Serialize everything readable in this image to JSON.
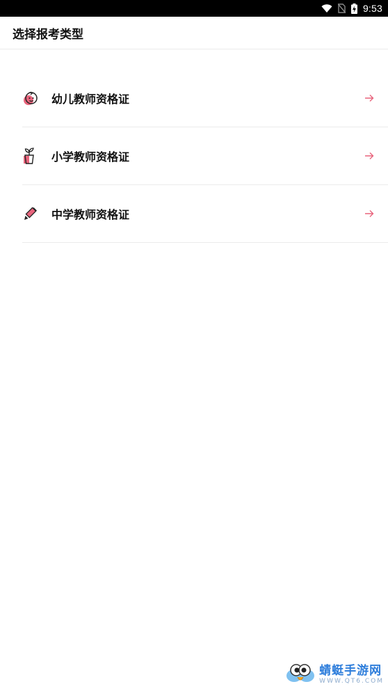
{
  "status_bar": {
    "time": "9:53",
    "icons": [
      "wifi-icon",
      "no-sim-icon",
      "battery-charging-icon"
    ]
  },
  "header": {
    "title": "选择报考类型"
  },
  "exam_types": [
    {
      "label": "幼儿教师资格证",
      "icon": "baby-face-icon"
    },
    {
      "label": "小学教师资格证",
      "icon": "sprout-icon"
    },
    {
      "label": "中学教师资格证",
      "icon": "pen-icon"
    }
  ],
  "colors": {
    "accent": "#e8647c",
    "accent_light": "#f3a9b8",
    "text": "#111111",
    "divider": "#ebebeb"
  },
  "watermark": {
    "title": "蜻蜓手游网",
    "subtitle": "WWW.QT6.COM"
  }
}
